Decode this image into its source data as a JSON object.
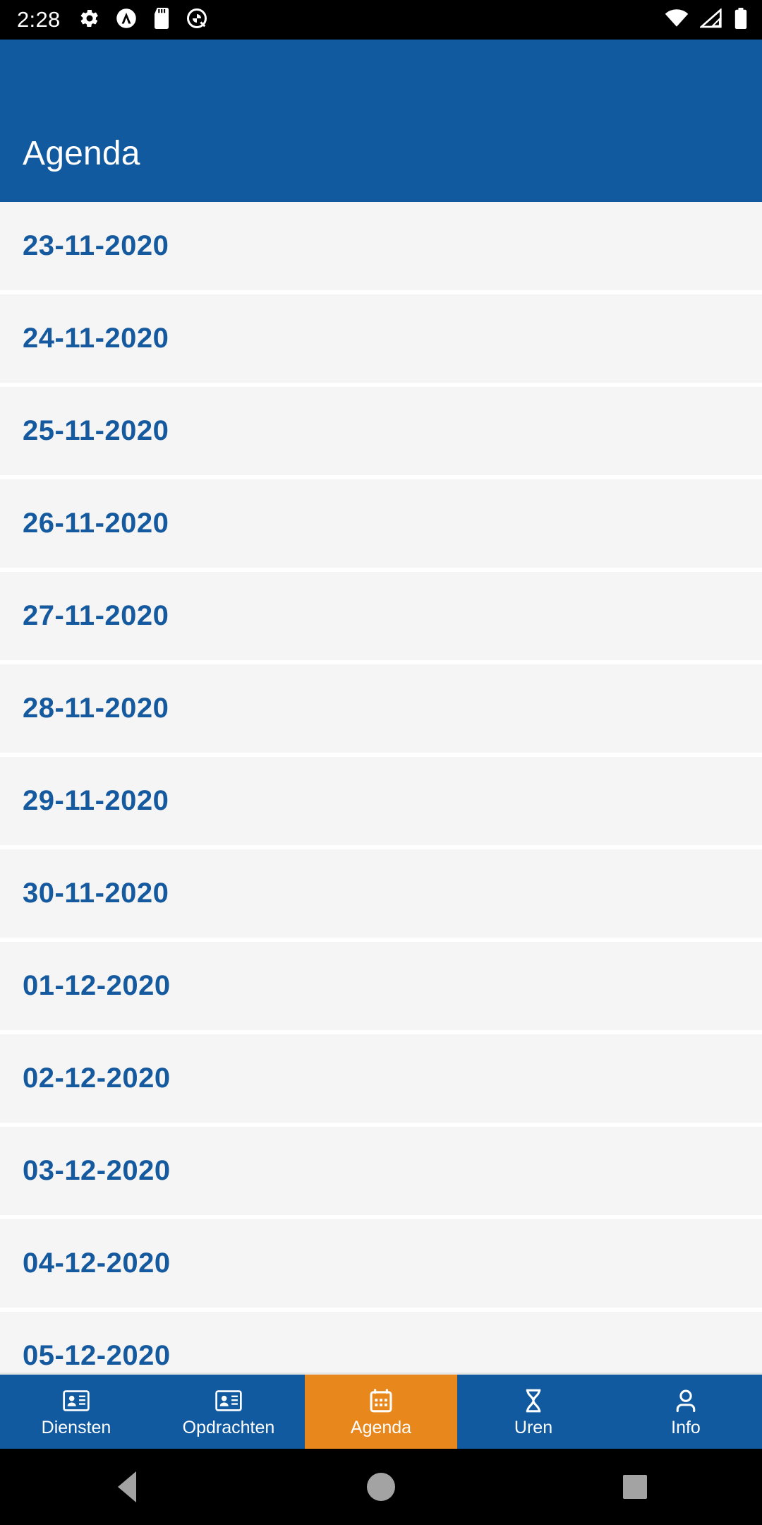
{
  "statusbar": {
    "time": "2:28",
    "left_icons": [
      "gear-icon",
      "adguard-icon",
      "sd-card-icon",
      "quick-settings-icon"
    ],
    "right_icons": [
      "wifi-icon",
      "cellular-signal-icon",
      "battery-icon"
    ]
  },
  "appbar": {
    "title": "Agenda",
    "background_color": "#115aa0",
    "title_color": "#ffffff"
  },
  "list": {
    "row_background_color": "#f5f5f5",
    "date_text_color": "#15599f",
    "items": [
      {
        "date": "23-11-2020"
      },
      {
        "date": "24-11-2020"
      },
      {
        "date": "25-11-2020"
      },
      {
        "date": "26-11-2020"
      },
      {
        "date": "27-11-2020"
      },
      {
        "date": "28-11-2020"
      },
      {
        "date": "29-11-2020"
      },
      {
        "date": "30-11-2020"
      },
      {
        "date": "01-12-2020"
      },
      {
        "date": "02-12-2020"
      },
      {
        "date": "03-12-2020"
      },
      {
        "date": "04-12-2020"
      },
      {
        "date": "05-12-2020"
      }
    ]
  },
  "bottomnav": {
    "background_color": "#115aa0",
    "active_color": "#e8871c",
    "active_index": 2,
    "tabs": [
      {
        "label": "Diensten",
        "icon": "contact-card-icon",
        "active": false
      },
      {
        "label": "Opdrachten",
        "icon": "contact-card-icon",
        "active": false
      },
      {
        "label": "Agenda",
        "icon": "calendar-icon",
        "active": true
      },
      {
        "label": "Uren",
        "icon": "hourglass-icon",
        "active": false
      },
      {
        "label": "Info",
        "icon": "person-icon",
        "active": false
      }
    ]
  },
  "sysnav": {
    "buttons": [
      {
        "name": "back-button",
        "icon": "triangle-back-icon"
      },
      {
        "name": "home-button",
        "icon": "circle-home-icon"
      },
      {
        "name": "recents-button",
        "icon": "square-recents-icon"
      }
    ],
    "icon_color": "#a3a3a3"
  }
}
